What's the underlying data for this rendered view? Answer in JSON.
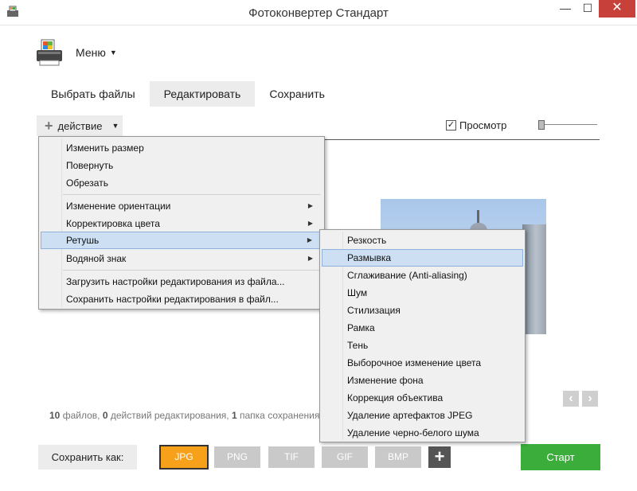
{
  "window": {
    "title": "Фотоконвертер Стандарт",
    "minimize": "—",
    "maximize": "☐",
    "close": "✕"
  },
  "menu": {
    "label": "Меню",
    "caret": "▼"
  },
  "tabs": [
    {
      "label": "Выбрать файлы",
      "active": false
    },
    {
      "label": "Редактировать",
      "active": true
    },
    {
      "label": "Сохранить",
      "active": false
    }
  ],
  "toolbar": {
    "action_label": "действие",
    "action_caret": "▼",
    "preview_label": "Просмотр",
    "preview_checked": true
  },
  "action_menu": {
    "items": [
      {
        "label": "Изменить размер",
        "submenu": false
      },
      {
        "label": "Повернуть",
        "submenu": false
      },
      {
        "label": "Обрезать",
        "submenu": false
      },
      {
        "label": "Изменение ориентации",
        "submenu": true
      },
      {
        "label": "Корректировка цвета",
        "submenu": true
      },
      {
        "label": "Ретушь",
        "submenu": true,
        "highlighted": true
      },
      {
        "label": "Водяной знак",
        "submenu": true
      },
      {
        "label": "Загрузить настройки редактирования из файла...",
        "submenu": false
      },
      {
        "label": "Сохранить настройки редактирования в файл...",
        "submenu": false
      }
    ]
  },
  "retouch_menu": {
    "items": [
      {
        "label": "Резкость"
      },
      {
        "label": "Размывка",
        "highlighted": true
      },
      {
        "label": "Сглаживание (Anti-aliasing)"
      },
      {
        "label": "Шум"
      },
      {
        "label": "Стилизация"
      },
      {
        "label": "Рамка"
      },
      {
        "label": "Тень"
      },
      {
        "label": "Выборочное изменение цвета"
      },
      {
        "label": "Изменение фона"
      },
      {
        "label": "Коррекция объектива"
      },
      {
        "label": "Удаление артефактов JPEG"
      },
      {
        "label": "Удаление черно-белого шума"
      }
    ]
  },
  "status": {
    "files_count": "10",
    "files_text": "файлов,",
    "actions_count": "0",
    "actions_text": "действий редактирования,",
    "folders_count": "1",
    "folders_text": "папка сохранения"
  },
  "bottom": {
    "save_as_label": "Сохранить как:",
    "formats": [
      {
        "label": "JPG",
        "active": true
      },
      {
        "label": "PNG",
        "active": false
      },
      {
        "label": "TIF",
        "active": false
      },
      {
        "label": "GIF",
        "active": false
      },
      {
        "label": "BMP",
        "active": false
      }
    ],
    "add_format": "+",
    "start_label": "Старт"
  },
  "nav": {
    "prev": "‹",
    "next": "›"
  },
  "colors": {
    "accent_orange": "#f7a11a",
    "start_green": "#3aad3a",
    "menu_highlight": "#cddff2",
    "close_red": "#c7403a"
  }
}
